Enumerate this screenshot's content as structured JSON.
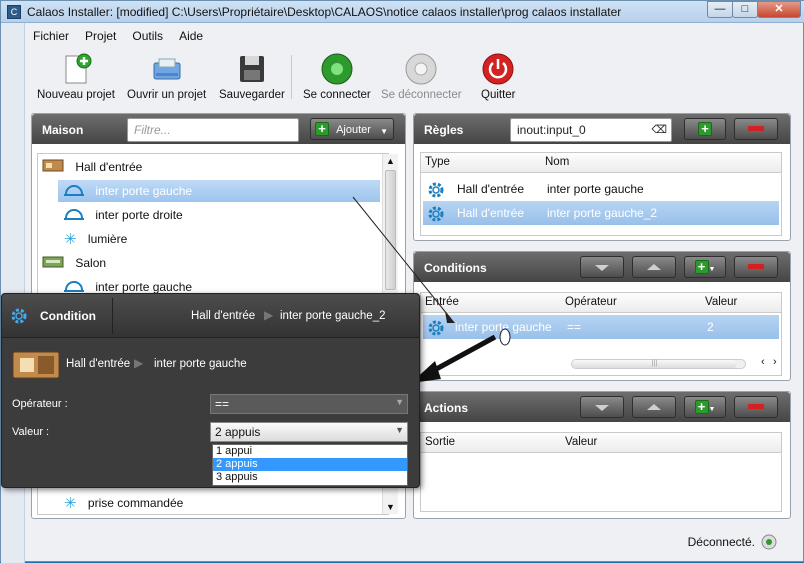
{
  "window": {
    "title": "Calaos Installer: [modified] C:\\Users\\Propriétaire\\Desktop\\CALAOS\\notice calaos installer\\prog calaos installater",
    "minimize_glyph": "—",
    "maximize_glyph": "□",
    "close_glyph": "✕"
  },
  "menu": [
    "Fichier",
    "Projet",
    "Outils",
    "Aide"
  ],
  "toolbar": {
    "new_project": "Nouveau projet",
    "open_project": "Ouvrir un projet",
    "save": "Sauvegarder",
    "connect": "Se connecter",
    "disconnect": "Se déconnecter",
    "quit": "Quitter"
  },
  "maison": {
    "title": "Maison",
    "filter_placeholder": "Filtre...",
    "add_label": "Ajouter",
    "tree": [
      {
        "label": "Hall d'entrée",
        "type": "room"
      },
      {
        "label": "inter porte gauche",
        "type": "switch",
        "selected": true
      },
      {
        "label": "inter porte droite",
        "type": "switch"
      },
      {
        "label": "lumière",
        "type": "light"
      },
      {
        "label": "Salon",
        "type": "room"
      },
      {
        "label": "inter porte gauche",
        "type": "switch"
      }
    ],
    "bottom_item": "prise commandée"
  },
  "regles": {
    "title": "Règles",
    "search_value": "inout:input_0",
    "columns": [
      "Type",
      "Nom"
    ],
    "rows": [
      {
        "type": "Hall d'entrée",
        "name": "inter porte gauche"
      },
      {
        "type": "Hall d'entrée",
        "name": "inter porte gauche_2",
        "selected": true
      }
    ]
  },
  "conditions": {
    "title": "Conditions",
    "columns": [
      "Entrée",
      "Opérateur",
      "Valeur"
    ],
    "rows": [
      {
        "entree": "inter porte gauche",
        "operateur": "==",
        "valeur": "2",
        "selected": true
      }
    ]
  },
  "actions": {
    "title": "Actions",
    "columns": [
      "Sortie",
      "Valeur"
    ]
  },
  "status": {
    "text": "Déconnecté."
  },
  "condition_dialog": {
    "title": "Condition",
    "breadcrumb_room": "Hall d'entrée",
    "breadcrumb_item": "inter porte gauche_2",
    "source_room": "Hall d'entrée",
    "source_item": "inter porte gauche",
    "operator_label": "Opérateur :",
    "operator_value": "==",
    "value_label": "Valeur :",
    "value_selected": "2 appuis",
    "value_options": [
      "1 appui",
      "2 appuis",
      "3 appuis"
    ]
  },
  "colors": {
    "accent_blue": "#3399ff",
    "panel_header": "#4d4d4d",
    "add_green": "#2b9c2b",
    "remove_red": "#d42020"
  }
}
